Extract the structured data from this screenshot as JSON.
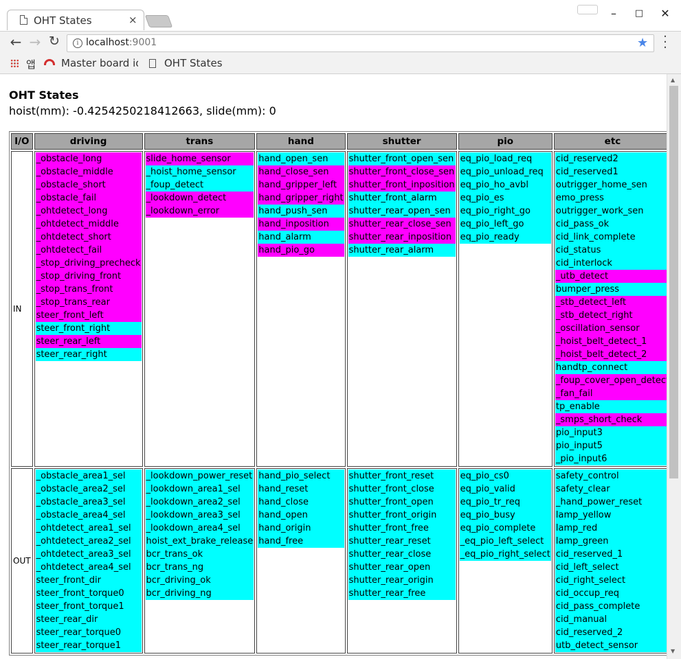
{
  "browser": {
    "tab_title": "OHT States",
    "tab_close": "×",
    "url_host": "localhost",
    "url_port": ":9001",
    "bookmarks": [
      {
        "label": "앱"
      },
      {
        "label": "Master board io"
      },
      {
        "label": "OHT States"
      }
    ],
    "window_controls": {
      "minimize": "–",
      "maximize": "□",
      "close": "✕"
    }
  },
  "page": {
    "title": "OHT States",
    "status": "hoist(mm): -0.4254250218412663, slide(mm): 0"
  },
  "table": {
    "headers": [
      "I/O",
      "driving",
      "trans",
      "hand",
      "shutter",
      "pio",
      "etc"
    ],
    "rows": [
      {
        "io": "IN",
        "columns": [
          [
            {
              "name": "_obstacle_long",
              "on": true
            },
            {
              "name": "_obstacle_middle",
              "on": true
            },
            {
              "name": "_obstacle_short",
              "on": true
            },
            {
              "name": "_obstacle_fail",
              "on": true
            },
            {
              "name": "_ohtdetect_long",
              "on": true
            },
            {
              "name": "_ohtdetect_middle",
              "on": true
            },
            {
              "name": "_ohtdetect_short",
              "on": true
            },
            {
              "name": "_ohtdetect_fail",
              "on": true
            },
            {
              "name": "_stop_driving_precheck",
              "on": true
            },
            {
              "name": "_stop_driving_front",
              "on": true
            },
            {
              "name": "_stop_trans_front",
              "on": true
            },
            {
              "name": "_stop_trans_rear",
              "on": true
            },
            {
              "name": "steer_front_left",
              "on": true
            },
            {
              "name": "steer_front_right",
              "on": false
            },
            {
              "name": "steer_rear_left",
              "on": true
            },
            {
              "name": "steer_rear_right",
              "on": false
            }
          ],
          [
            {
              "name": "slide_home_sensor",
              "on": true
            },
            {
              "name": "_hoist_home_sensor",
              "on": false
            },
            {
              "name": "_foup_detect",
              "on": false
            },
            {
              "name": "_lookdown_detect",
              "on": true
            },
            {
              "name": "_lookdown_error",
              "on": true
            }
          ],
          [
            {
              "name": "hand_open_sen",
              "on": false
            },
            {
              "name": "hand_close_sen",
              "on": true
            },
            {
              "name": "hand_gripper_left",
              "on": true
            },
            {
              "name": "hand_gripper_right",
              "on": true
            },
            {
              "name": "hand_push_sen",
              "on": false
            },
            {
              "name": "hand_inposition",
              "on": true
            },
            {
              "name": "hand_alarm",
              "on": false
            },
            {
              "name": "hand_pio_go",
              "on": true
            }
          ],
          [
            {
              "name": "shutter_front_open_sen",
              "on": false
            },
            {
              "name": "shutter_front_close_sen",
              "on": true
            },
            {
              "name": "shutter_front_inposition",
              "on": true
            },
            {
              "name": "shutter_front_alarm",
              "on": false
            },
            {
              "name": "shutter_rear_open_sen",
              "on": false
            },
            {
              "name": "shutter_rear_close_sen",
              "on": true
            },
            {
              "name": "shutter_rear_inposition",
              "on": true
            },
            {
              "name": "shutter_rear_alarm",
              "on": false
            }
          ],
          [
            {
              "name": "eq_pio_load_req",
              "on": false
            },
            {
              "name": "eq_pio_unload_req",
              "on": false
            },
            {
              "name": "eq_pio_ho_avbl",
              "on": false
            },
            {
              "name": "eq_pio_es",
              "on": false
            },
            {
              "name": "eq_pio_right_go",
              "on": false
            },
            {
              "name": "eq_pio_left_go",
              "on": false
            },
            {
              "name": "eq_pio_ready",
              "on": false
            }
          ],
          [
            {
              "name": "cid_reserved2",
              "on": false
            },
            {
              "name": "cid_reserved1",
              "on": false
            },
            {
              "name": "outrigger_home_sen",
              "on": false
            },
            {
              "name": "emo_press",
              "on": false
            },
            {
              "name": "outrigger_work_sen",
              "on": false
            },
            {
              "name": "cid_pass_ok",
              "on": false
            },
            {
              "name": "cid_link_complete",
              "on": false
            },
            {
              "name": "cid_status",
              "on": false
            },
            {
              "name": "cid_interlock",
              "on": false
            },
            {
              "name": "_utb_detect",
              "on": true
            },
            {
              "name": "bumper_press",
              "on": false
            },
            {
              "name": "_stb_detect_left",
              "on": true
            },
            {
              "name": "_stb_detect_right",
              "on": true
            },
            {
              "name": "_oscillation_sensor",
              "on": true
            },
            {
              "name": "_hoist_belt_detect_1",
              "on": true
            },
            {
              "name": "_hoist_belt_detect_2",
              "on": true
            },
            {
              "name": "handtp_connect",
              "on": false
            },
            {
              "name": "_foup_cover_open_detect",
              "on": true
            },
            {
              "name": "_fan_fail",
              "on": true
            },
            {
              "name": "tp_enable",
              "on": false
            },
            {
              "name": "_smps_short_check",
              "on": true
            },
            {
              "name": "pio_input3",
              "on": false
            },
            {
              "name": "pio_input5",
              "on": false
            },
            {
              "name": "_pio_input6",
              "on": false
            }
          ]
        ]
      },
      {
        "io": "OUT",
        "columns": [
          [
            {
              "name": "_obstacle_area1_sel",
              "on": false
            },
            {
              "name": "_obstacle_area2_sel",
              "on": false
            },
            {
              "name": "_obstacle_area3_sel",
              "on": false
            },
            {
              "name": "_obstacle_area4_sel",
              "on": false
            },
            {
              "name": "_ohtdetect_area1_sel",
              "on": false
            },
            {
              "name": "_ohtdetect_area2_sel",
              "on": false
            },
            {
              "name": "_ohtdetect_area3_sel",
              "on": false
            },
            {
              "name": "_ohtdetect_area4_sel",
              "on": false
            },
            {
              "name": "steer_front_dir",
              "on": false
            },
            {
              "name": "steer_front_torque0",
              "on": false
            },
            {
              "name": "steer_front_torque1",
              "on": false
            },
            {
              "name": "steer_rear_dir",
              "on": false
            },
            {
              "name": "steer_rear_torque0",
              "on": false
            },
            {
              "name": "steer_rear_torque1",
              "on": false
            }
          ],
          [
            {
              "name": "_lookdown_power_reset",
              "on": false
            },
            {
              "name": "_lookdown_area1_sel",
              "on": false
            },
            {
              "name": "_lookdown_area2_sel",
              "on": false
            },
            {
              "name": "_lookdown_area3_sel",
              "on": false
            },
            {
              "name": "_lookdown_area4_sel",
              "on": false
            },
            {
              "name": "hoist_ext_brake_release",
              "on": false
            },
            {
              "name": "bcr_trans_ok",
              "on": false
            },
            {
              "name": "bcr_trans_ng",
              "on": false
            },
            {
              "name": "bcr_driving_ok",
              "on": false
            },
            {
              "name": "bcr_driving_ng",
              "on": false
            }
          ],
          [
            {
              "name": "hand_pio_select",
              "on": false
            },
            {
              "name": "hand_reset",
              "on": false
            },
            {
              "name": "hand_close",
              "on": false
            },
            {
              "name": "hand_open",
              "on": false
            },
            {
              "name": "hand_origin",
              "on": false
            },
            {
              "name": "hand_free",
              "on": false
            }
          ],
          [
            {
              "name": "shutter_front_reset",
              "on": false
            },
            {
              "name": "shutter_front_close",
              "on": false
            },
            {
              "name": "shutter_front_open",
              "on": false
            },
            {
              "name": "shutter_front_origin",
              "on": false
            },
            {
              "name": "shutter_front_free",
              "on": false
            },
            {
              "name": "shutter_rear_reset",
              "on": false
            },
            {
              "name": "shutter_rear_close",
              "on": false
            },
            {
              "name": "shutter_rear_open",
              "on": false
            },
            {
              "name": "shutter_rear_origin",
              "on": false
            },
            {
              "name": "shutter_rear_free",
              "on": false
            }
          ],
          [
            {
              "name": "eq_pio_cs0",
              "on": false
            },
            {
              "name": "eq_pio_valid",
              "on": false
            },
            {
              "name": "eq_pio_tr_req",
              "on": false
            },
            {
              "name": "eq_pio_busy",
              "on": false
            },
            {
              "name": "eq_pio_complete",
              "on": false
            },
            {
              "name": "_eq_pio_left_select",
              "on": false
            },
            {
              "name": "_eq_pio_right_select",
              "on": false
            }
          ],
          [
            {
              "name": "safety_control",
              "on": false
            },
            {
              "name": "safety_clear",
              "on": false
            },
            {
              "name": "_hand_power_reset",
              "on": false
            },
            {
              "name": "lamp_yellow",
              "on": false
            },
            {
              "name": "lamp_red",
              "on": false
            },
            {
              "name": "lamp_green",
              "on": false
            },
            {
              "name": "cid_reserved_1",
              "on": false
            },
            {
              "name": "cid_left_select",
              "on": false
            },
            {
              "name": "cid_right_select",
              "on": false
            },
            {
              "name": "cid_occup_req",
              "on": false
            },
            {
              "name": "cid_pass_complete",
              "on": false
            },
            {
              "name": "cid_manual",
              "on": false
            },
            {
              "name": "cid_reserved_2",
              "on": false
            },
            {
              "name": "utb_detect_sensor",
              "on": false
            }
          ]
        ]
      }
    ]
  },
  "colors": {
    "signal_on": "#ff00ff",
    "signal_off": "#00ffff",
    "header_bg": "#a6a6a6"
  }
}
